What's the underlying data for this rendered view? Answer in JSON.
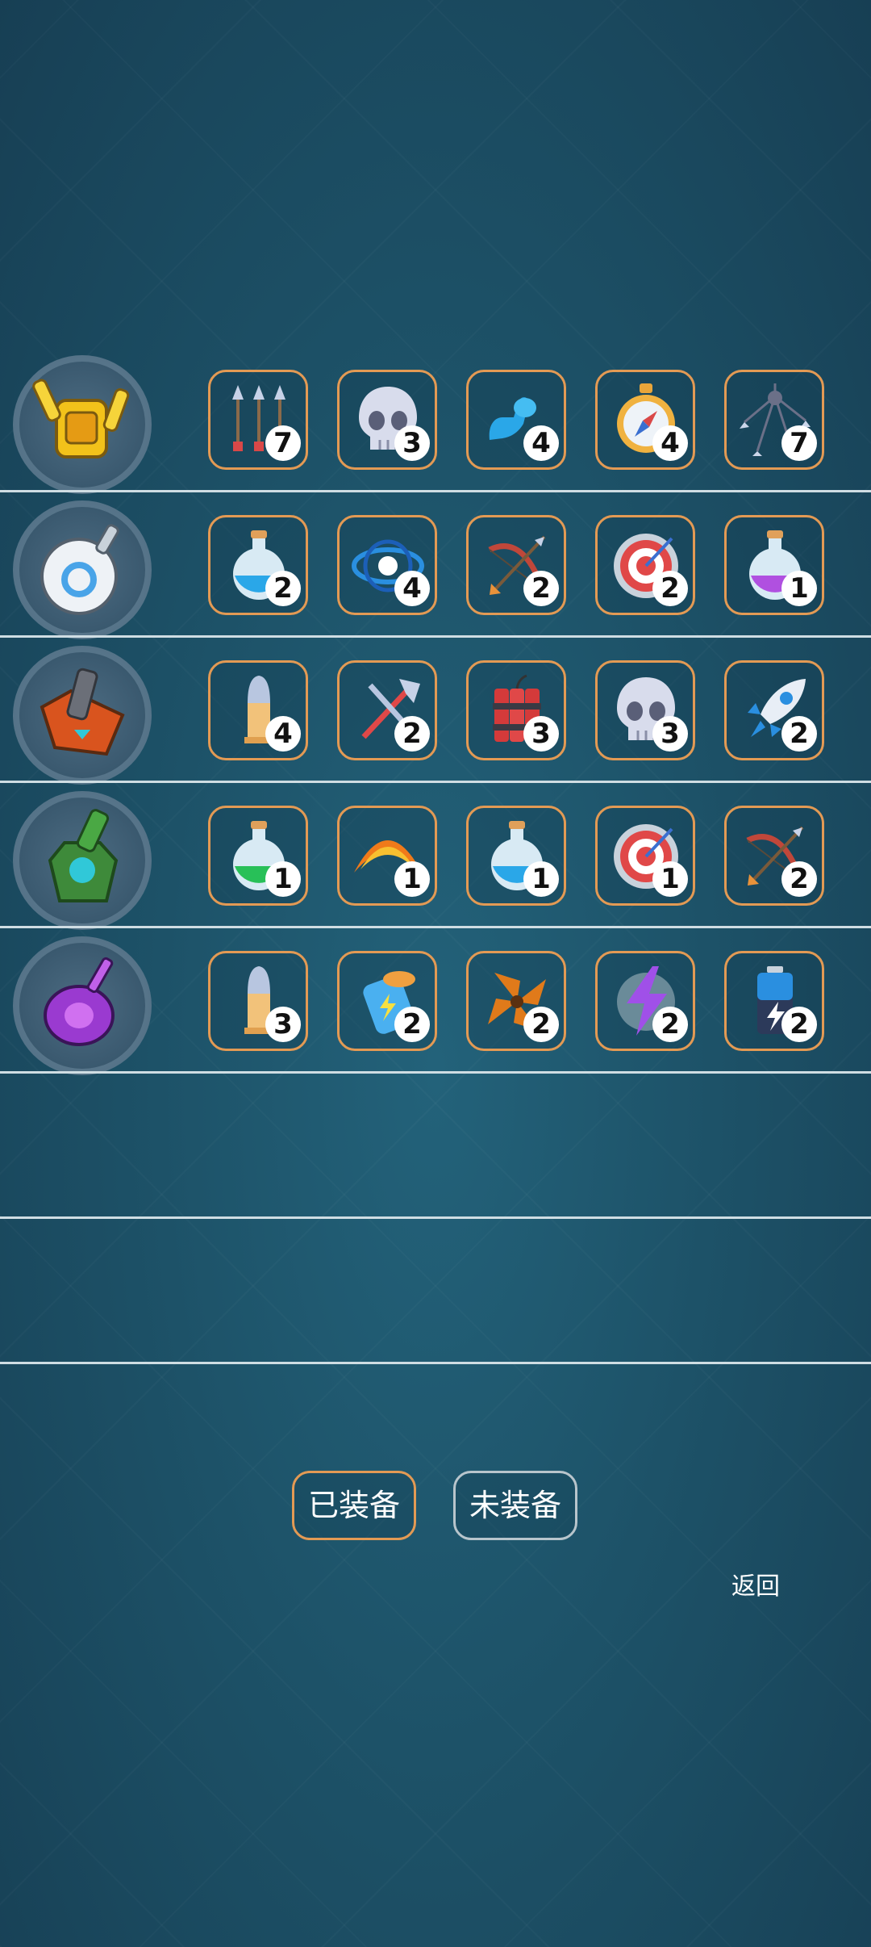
{
  "rows": [
    {
      "tank_icon": "yellow-twin-cannon-tank-icon",
      "skills": [
        {
          "icon": "triple-arrows-icon",
          "count": "7"
        },
        {
          "icon": "skull-icon",
          "count": "3"
        },
        {
          "icon": "flexed-arm-icon",
          "count": "4"
        },
        {
          "icon": "compass-icon",
          "count": "4"
        },
        {
          "icon": "multi-arrow-spread-icon",
          "count": "7"
        }
      ]
    },
    {
      "tank_icon": "white-orb-tank-icon",
      "skills": [
        {
          "icon": "blue-potion-icon",
          "count": "2"
        },
        {
          "icon": "vortex-icon",
          "count": "4"
        },
        {
          "icon": "bow-arrow-icon",
          "count": "2"
        },
        {
          "icon": "target-icon",
          "count": "2"
        },
        {
          "icon": "purple-potion-icon",
          "count": "1"
        }
      ]
    },
    {
      "tank_icon": "orange-cannon-tank-icon",
      "skills": [
        {
          "icon": "bullet-icon",
          "count": "4"
        },
        {
          "icon": "crossed-axes-icon",
          "count": "2"
        },
        {
          "icon": "dynamite-icon",
          "count": "3"
        },
        {
          "icon": "skull-icon",
          "count": "3"
        },
        {
          "icon": "rocket-icon",
          "count": "2"
        }
      ]
    },
    {
      "tank_icon": "green-bottle-tank-icon",
      "skills": [
        {
          "icon": "green-potion-icon",
          "count": "1"
        },
        {
          "icon": "fire-arc-icon",
          "count": "1"
        },
        {
          "icon": "blue-potion-icon",
          "count": "1"
        },
        {
          "icon": "target-icon",
          "count": "1"
        },
        {
          "icon": "bow-arrow-icon",
          "count": "2"
        }
      ]
    },
    {
      "tank_icon": "purple-crystal-tank-icon",
      "skills": [
        {
          "icon": "bullet-icon",
          "count": "3"
        },
        {
          "icon": "energy-canister-icon",
          "count": "2"
        },
        {
          "icon": "spinning-blade-icon",
          "count": "2"
        },
        {
          "icon": "lightning-icon",
          "count": "2"
        },
        {
          "icon": "battery-icon",
          "count": "2"
        }
      ]
    },
    {
      "tank_icon": "",
      "skills": []
    },
    {
      "tank_icon": "",
      "skills": []
    }
  ],
  "tabs": {
    "equipped_label": "已装备",
    "unequipped_label": "未装备"
  },
  "back_label": "返回",
  "colors": {
    "slot_border": "#e39a54",
    "divider": "#cfdde3",
    "background": "#1d5268"
  }
}
